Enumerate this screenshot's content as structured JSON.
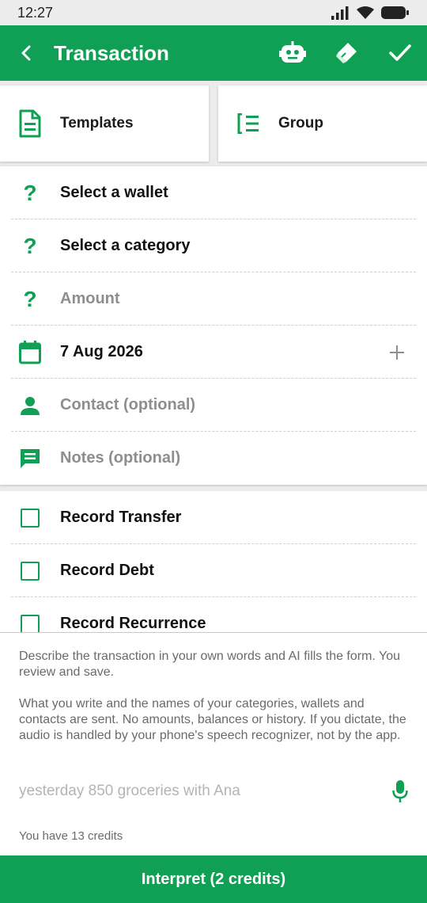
{
  "status_bar": {
    "time": "12:27"
  },
  "app_bar": {
    "title": "Transaction"
  },
  "top_cards": {
    "templates_label": "Templates",
    "group_label": "Group"
  },
  "form": {
    "wallet": "Select a wallet",
    "category": "Select a category",
    "amount_placeholder": "Amount",
    "date": "7 Aug 2026",
    "contact_placeholder": "Contact (optional)",
    "notes_placeholder": "Notes (optional)"
  },
  "options": [
    {
      "label": "Record Transfer",
      "checked": false
    },
    {
      "label": "Record Debt",
      "checked": false
    },
    {
      "label": "Record Recurrence",
      "checked": false
    }
  ],
  "ai_panel": {
    "intro": "Describe the transaction in your own words and AI fills the form. You review and save.",
    "privacy": "What you write and the names of your categories, wallets and contacts are sent. No amounts, balances or history. If you dictate, the audio is handled by your phone's speech recognizer, not by the app.",
    "input_placeholder": "yesterday 850 groceries with Ana",
    "credits_text": "You have 13 credits"
  },
  "cta": {
    "label": "Interpret (2 credits)"
  },
  "colors": {
    "accent": "#10a055",
    "muted_text": "#8e8e8e"
  },
  "icons": {
    "templates": "document-icon",
    "group": "group-list-icon",
    "robot": "robot-icon",
    "eraser": "eraser-icon",
    "save": "check-icon",
    "back": "back-icon",
    "calendar": "calendar-icon",
    "contact": "person-icon",
    "notes": "comment-icon",
    "mic": "microphone-icon",
    "add": "plus-icon"
  }
}
